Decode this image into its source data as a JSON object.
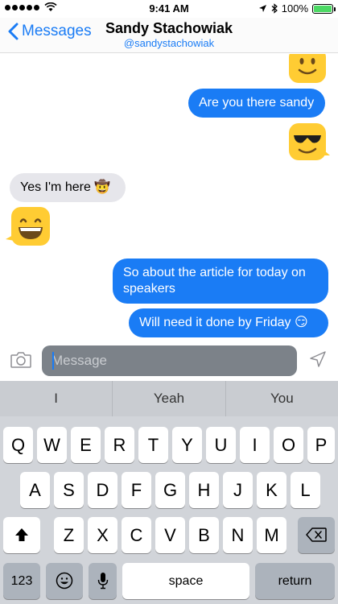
{
  "status_bar": {
    "time": "9:41 AM",
    "battery": "100%"
  },
  "nav": {
    "back_label": "Messages",
    "title": "Sandy Stachowiak",
    "subtitle": "@sandystachowiak"
  },
  "messages": [
    {
      "direction": "out",
      "type": "sticker",
      "emoji": "smile-emoji"
    },
    {
      "direction": "out",
      "type": "text",
      "text": "Are you there sandy"
    },
    {
      "direction": "out",
      "type": "sticker",
      "emoji": "sunglasses-emoji"
    },
    {
      "direction": "in",
      "type": "text",
      "text": "Yes I'm here 🤠"
    },
    {
      "direction": "in",
      "type": "sticker",
      "emoji": "grin-emoji"
    },
    {
      "direction": "out",
      "type": "text",
      "text": "So about the article for today on speakers"
    },
    {
      "direction": "out",
      "type": "text",
      "text": "Will need it done by Friday 😏"
    }
  ],
  "input": {
    "placeholder": "Message"
  },
  "predictions": [
    "I",
    "Yeah",
    "You"
  ],
  "keyboard": {
    "row1": [
      "Q",
      "W",
      "E",
      "R",
      "T",
      "Y",
      "U",
      "I",
      "O",
      "P"
    ],
    "row2": [
      "A",
      "S",
      "D",
      "F",
      "G",
      "H",
      "J",
      "K",
      "L"
    ],
    "row3": [
      "Z",
      "X",
      "C",
      "V",
      "B",
      "N",
      "M"
    ],
    "numbers_label": "123",
    "space_label": "space",
    "return_label": "return"
  },
  "colors": {
    "accent": "#1a7cf5",
    "incoming_bubble": "#e6e6eb",
    "keyboard_bg": "#d1d4d9",
    "emoji_yellow": "#ffcc33"
  }
}
